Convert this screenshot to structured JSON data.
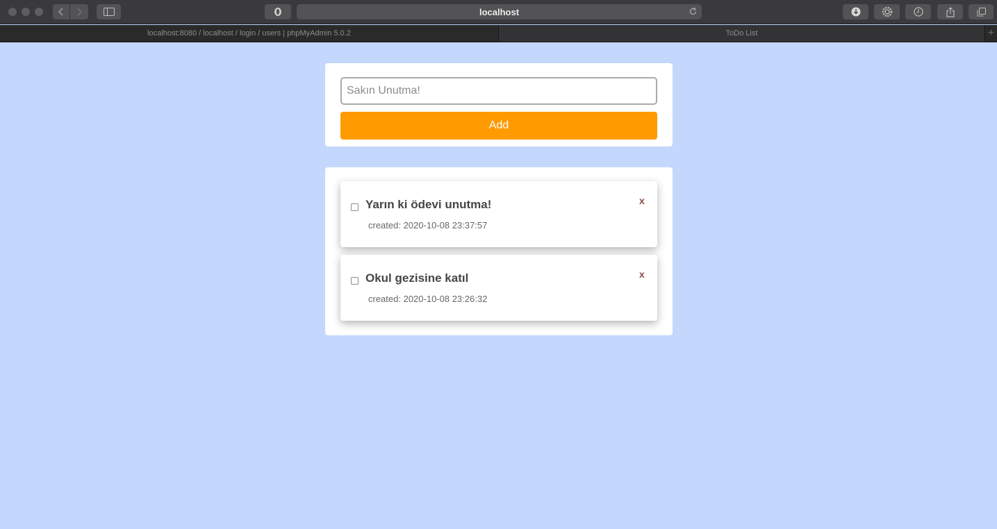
{
  "browser": {
    "address": "localhost",
    "tabs": [
      {
        "title": "localhost:8080 / localhost / login / users | phpMyAdmin 5.0.2",
        "active": false
      },
      {
        "title": "ToDo List",
        "active": true
      }
    ],
    "new_tab_symbol": "+",
    "icons": [
      "back-icon",
      "forward-icon",
      "sidebar-icon",
      "privacy-shield-icon",
      "reload-icon",
      "download-icon",
      "settings-gear-icon",
      "history-clock-icon",
      "share-icon",
      "tabs-overview-icon"
    ]
  },
  "todo": {
    "input_placeholder": "Sakın Unutma!",
    "add_label": "Add",
    "delete_label": "x",
    "items": [
      {
        "title": "Yarın ki ödevi unutma!",
        "created": "created: 2020-10-08 23:37:57",
        "checked": false
      },
      {
        "title": "Okul gezisine katıl",
        "created": "created: 2020-10-08 23:26:32",
        "checked": false
      }
    ]
  },
  "colors": {
    "page_background": "#c4d7fd",
    "add_button": "#ff9a00",
    "delete_x": "#8b4a4a"
  }
}
